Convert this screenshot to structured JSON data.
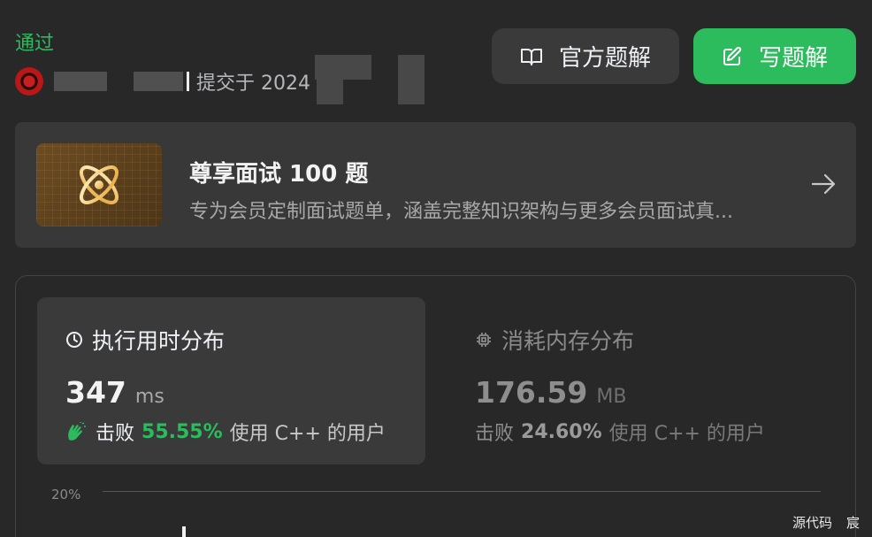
{
  "submission": {
    "status": "通过",
    "submitted_text": "提交于 2024"
  },
  "buttons": {
    "official_solution": "官方题解",
    "write_solution": "写题解"
  },
  "promo": {
    "title": "尊享面试 100 题",
    "description": "专为会员定制面试题单，涵盖完整知识架构与更多会员面试真..."
  },
  "runtime": {
    "title": "执行用时分布",
    "value": "347",
    "unit": "ms",
    "beat_prefix": "击败",
    "beat_percent": "55.55%",
    "beat_suffix": "使用 C++ 的用户"
  },
  "memory": {
    "title": "消耗内存分布",
    "value": "176.59",
    "unit": "MB",
    "beat_prefix": "击败",
    "beat_percent": "24.60%",
    "beat_suffix": "使用 C++ 的用户"
  },
  "chart": {
    "y_tick": "20%"
  },
  "footer": {
    "source_code": "源代码",
    "user_fragment": "宸"
  },
  "colors": {
    "accent_green": "#2cbb5d",
    "background": "#282828",
    "card": "#3a3a3a"
  }
}
